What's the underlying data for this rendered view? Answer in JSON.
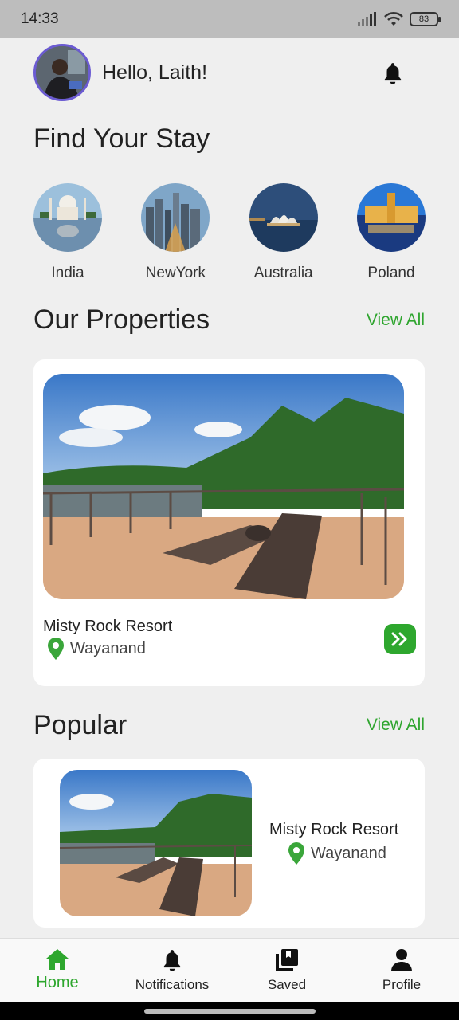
{
  "status_bar": {
    "time": "14:33",
    "battery": "83"
  },
  "header": {
    "greeting": "Hello, Laith!"
  },
  "find_stay": {
    "title": "Find Your Stay"
  },
  "destinations": [
    {
      "label": "India"
    },
    {
      "label": "NewYork"
    },
    {
      "label": "Australia"
    },
    {
      "label": "Poland"
    }
  ],
  "properties": {
    "title": "Our Properties",
    "view_all": "View All",
    "card": {
      "name": "Misty Rock Resort",
      "location": "Wayanand"
    }
  },
  "popular": {
    "title": "Popular",
    "view_all": "View All",
    "card": {
      "name": "Misty Rock Resort",
      "location": "Wayanand"
    }
  },
  "bottom_nav": {
    "items": [
      {
        "label": "Home",
        "icon": "home-icon",
        "active": true
      },
      {
        "label": "Notifications",
        "icon": "bell-icon",
        "active": false
      },
      {
        "label": "Saved",
        "icon": "saved-icon",
        "active": false
      },
      {
        "label": "Profile",
        "icon": "person-icon",
        "active": false
      }
    ]
  },
  "colors": {
    "accent": "#2ea72e",
    "background": "#efefef"
  }
}
